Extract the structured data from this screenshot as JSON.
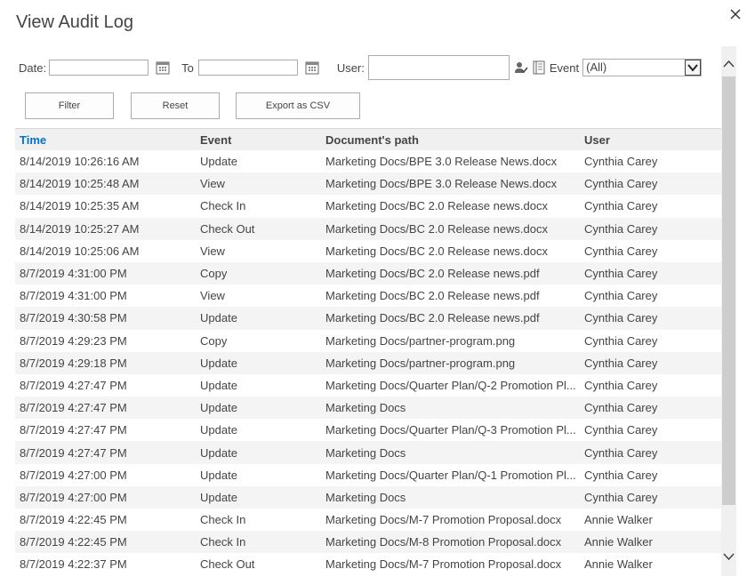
{
  "dialog": {
    "title": "View Audit Log"
  },
  "filters": {
    "date_label": "Date:",
    "date_value": "",
    "to_label": "To",
    "to_value": "",
    "user_label": "User:",
    "user_value": "",
    "event_label": "Event",
    "event_selected": "(All)"
  },
  "buttons": {
    "filter": "Filter",
    "reset": "Reset",
    "export": "Export as CSV"
  },
  "table": {
    "columns": [
      "Time",
      "Event",
      "Document's path",
      "User"
    ],
    "sorted_column": "Time",
    "rows": [
      [
        "8/14/2019 10:26:16 AM",
        "Update",
        "Marketing Docs/BPE 3.0 Release News.docx",
        "Cynthia Carey"
      ],
      [
        "8/14/2019 10:25:48 AM",
        "View",
        "Marketing Docs/BPE 3.0 Release News.docx",
        "Cynthia Carey"
      ],
      [
        "8/14/2019 10:25:35 AM",
        "Check In",
        "Marketing Docs/BC 2.0 Release news.docx",
        "Cynthia Carey"
      ],
      [
        "8/14/2019 10:25:27 AM",
        "Check Out",
        "Marketing Docs/BC 2.0 Release news.docx",
        "Cynthia Carey"
      ],
      [
        "8/14/2019 10:25:06 AM",
        "View",
        "Marketing Docs/BC 2.0 Release news.docx",
        "Cynthia Carey"
      ],
      [
        "8/7/2019 4:31:00 PM",
        "Copy",
        "Marketing Docs/BC 2.0 Release news.pdf",
        "Cynthia Carey"
      ],
      [
        "8/7/2019 4:31:00 PM",
        "View",
        "Marketing Docs/BC 2.0 Release news.pdf",
        "Cynthia Carey"
      ],
      [
        "8/7/2019 4:30:58 PM",
        "Update",
        "Marketing Docs/BC 2.0 Release news.pdf",
        "Cynthia Carey"
      ],
      [
        "8/7/2019 4:29:23 PM",
        "Copy",
        "Marketing Docs/partner-program.png",
        "Cynthia Carey"
      ],
      [
        "8/7/2019 4:29:18 PM",
        "Update",
        "Marketing Docs/partner-program.png",
        "Cynthia Carey"
      ],
      [
        "8/7/2019 4:27:47 PM",
        "Update",
        "Marketing Docs/Quarter Plan/Q-2 Promotion Pl...",
        "Cynthia Carey"
      ],
      [
        "8/7/2019 4:27:47 PM",
        "Update",
        "Marketing Docs",
        "Cynthia Carey"
      ],
      [
        "8/7/2019 4:27:47 PM",
        "Update",
        "Marketing Docs/Quarter Plan/Q-3 Promotion Pl...",
        "Cynthia Carey"
      ],
      [
        "8/7/2019 4:27:47 PM",
        "Update",
        "Marketing Docs",
        "Cynthia Carey"
      ],
      [
        "8/7/2019 4:27:00 PM",
        "Update",
        "Marketing Docs/Quarter Plan/Q-1 Promotion Pl...",
        "Cynthia Carey"
      ],
      [
        "8/7/2019 4:27:00 PM",
        "Update",
        "Marketing Docs",
        "Cynthia Carey"
      ],
      [
        "8/7/2019 4:22:45 PM",
        "Check In",
        "Marketing Docs/M-7 Promotion Proposal.docx",
        "Annie Walker"
      ],
      [
        "8/7/2019 4:22:45 PM",
        "Check In",
        "Marketing Docs/M-8 Promotion Proposal.docx",
        "Annie Walker"
      ],
      [
        "8/7/2019 4:22:37 PM",
        "Check Out",
        "Marketing Docs/M-7 Promotion Proposal.docx",
        "Annie Walker"
      ]
    ]
  },
  "icons": {
    "close": "close-icon",
    "calendar": "calendar-icon",
    "people_picker": "people-picker-icon",
    "browse": "address-book-icon",
    "dropdown": "chevron-down-icon",
    "scroll_up": "chevron-up-icon",
    "scroll_down": "chevron-down-icon"
  },
  "colors": {
    "accent": "#0072c6",
    "header_bg": "#f0f0f0",
    "alt_row_bg": "#f4f4f4",
    "text": "#444444"
  }
}
